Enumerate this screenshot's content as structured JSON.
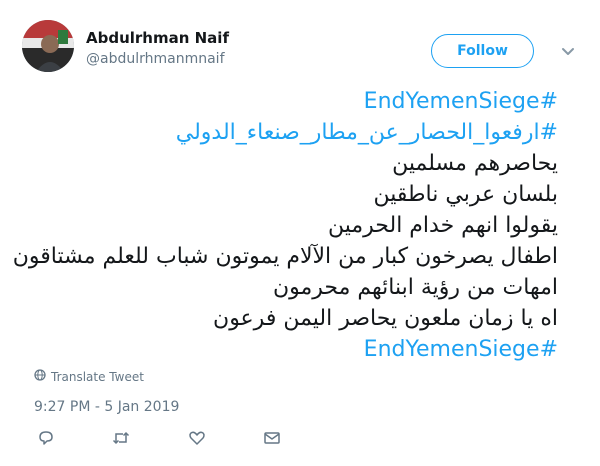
{
  "author": {
    "name": "Abdulrhman Naif",
    "handle": "@abdulrhmanmnaif"
  },
  "follow_label": "Follow",
  "tweet_lines": [
    {
      "text": "#EndYemenSiege",
      "hashtag": true
    },
    {
      "text": "#ارفعوا_الحصار_عن_مطار_صنعاء_الدولي",
      "hashtag": true
    },
    {
      "text": "يحاصرهم مسلمين",
      "hashtag": false
    },
    {
      "text": "بلسان عربي ناطقين",
      "hashtag": false
    },
    {
      "text": "يقولوا انهم خدام الحرمين",
      "hashtag": false
    },
    {
      "text": "اطفال يصرخون كبار من الآلام يموتون شباب للعلم مشتاقون",
      "hashtag": false
    },
    {
      "text": "امهات من رؤية ابنائهم محرمون",
      "hashtag": false
    },
    {
      "text": "اه يا زمان ملعون يحاصر اليمن فرعون",
      "hashtag": false
    },
    {
      "text": "#EndYemenSiege",
      "hashtag": true
    }
  ],
  "translate_label": "Translate Tweet",
  "timestamp": "9:27 PM - 5 Jan 2019",
  "colors": {
    "accent": "#1da1f2",
    "text": "#14171a",
    "muted": "#657786"
  },
  "icons": [
    "globe-icon",
    "chevron-down-icon",
    "reply-icon",
    "retweet-icon",
    "like-icon",
    "message-icon"
  ]
}
